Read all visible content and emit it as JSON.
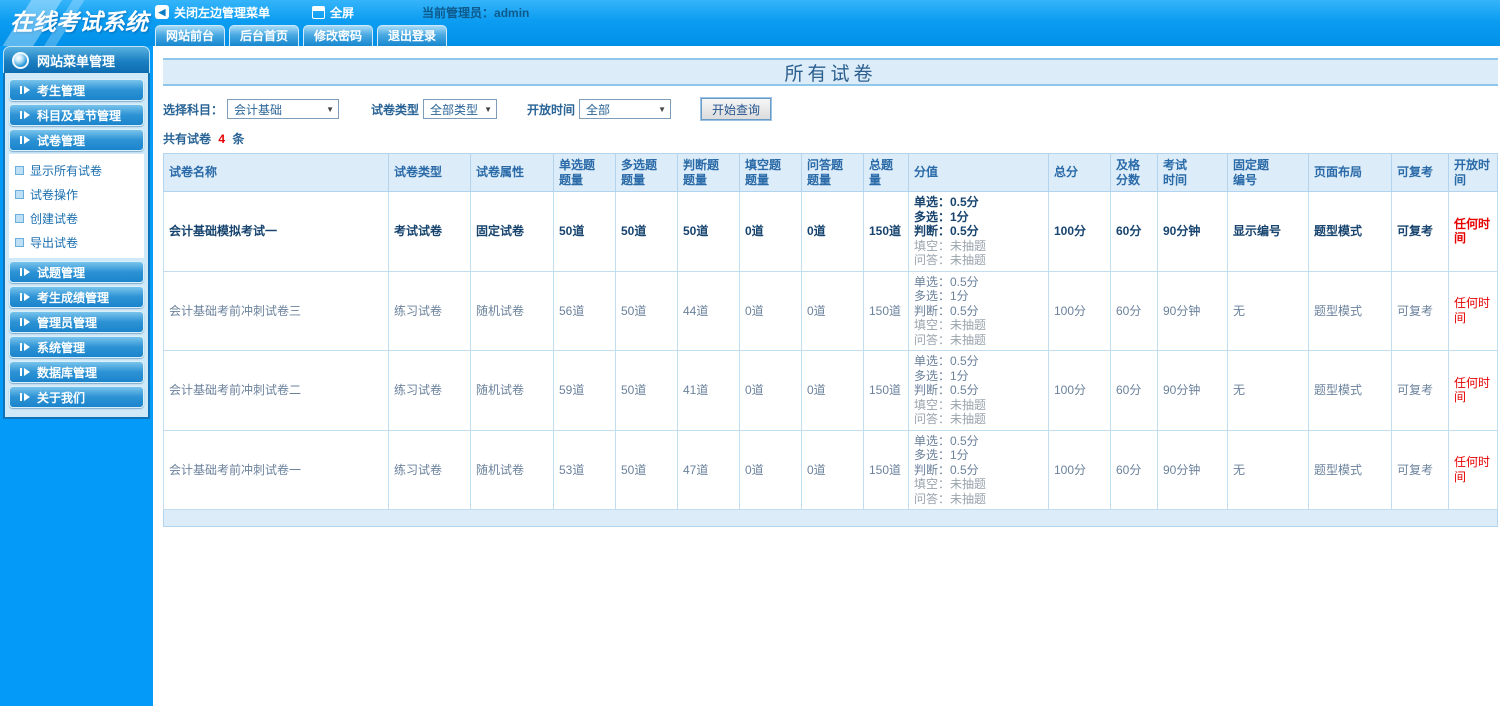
{
  "colors": {
    "topbar_blue": "#0c9df2",
    "sidebar_blue": "#049bf8",
    "accent_text": "#2a6496",
    "alert_red": "#e60000"
  },
  "topbar": {
    "logo": "在线考试系统",
    "close_menu_label": "关闭左边管理菜单",
    "fullscreen_label": "全屏",
    "admin_label": "当前管理员：admin",
    "tabs": [
      "网站前台",
      "后台首页",
      "修改密码",
      "退出登录"
    ]
  },
  "sidebar": {
    "header": "网站菜单管理",
    "items": [
      {
        "type": "button",
        "label": "考生管理"
      },
      {
        "type": "button",
        "label": "科目及章节管理"
      },
      {
        "type": "button",
        "label": "试卷管理"
      },
      {
        "type": "sub",
        "label": "显示所有试卷"
      },
      {
        "type": "sub",
        "label": "试卷操作"
      },
      {
        "type": "sub",
        "label": "创建试卷"
      },
      {
        "type": "sub",
        "label": "导出试卷"
      },
      {
        "type": "button",
        "label": "试题管理"
      },
      {
        "type": "button",
        "label": "考生成绩管理"
      },
      {
        "type": "button",
        "label": "管理员管理"
      },
      {
        "type": "button",
        "label": "系统管理"
      },
      {
        "type": "button",
        "label": "数据库管理"
      },
      {
        "type": "button",
        "label": "关于我们"
      }
    ]
  },
  "main": {
    "title": "所有试卷",
    "filters": {
      "subject_label": "选择科目：",
      "subject_value": "会计基础",
      "type_label": "试卷类型",
      "type_value": "全部类型",
      "time_label": "开放时间",
      "time_value": "全部",
      "search_button": "开始查询"
    },
    "summary": {
      "prefix": "共有试卷",
      "count": "4",
      "suffix": "条"
    },
    "table": {
      "headers": [
        [
          "试卷名称"
        ],
        [
          "试卷类型"
        ],
        [
          "试卷属性"
        ],
        [
          "单选题",
          "题量"
        ],
        [
          "多选题",
          "题量"
        ],
        [
          "判断题",
          "题量"
        ],
        [
          "填空题",
          "题量"
        ],
        [
          "问答题",
          "题量"
        ],
        [
          "总题量"
        ],
        [
          "分值"
        ],
        [
          "总分"
        ],
        [
          "及格",
          "分数"
        ],
        [
          "考试",
          "时间"
        ],
        [
          "固定题",
          "编号"
        ],
        [
          "页面布局"
        ],
        [
          "可复考"
        ],
        [
          "开放时间"
        ]
      ],
      "rows": [
        {
          "bold": true,
          "name": "会计基础模拟考试一",
          "type": "考试试卷",
          "attribute": "固定试卷",
          "single": "50道",
          "multi": "50道",
          "judge": "50道",
          "blank": "0道",
          "qa": "0道",
          "total_q": "150道",
          "score_lines": [
            {
              "text": "单选：0.5分",
              "muted": false
            },
            {
              "text": "多选：1分",
              "muted": false
            },
            {
              "text": "判断：0.5分",
              "muted": false
            },
            {
              "text": "填空：未抽题",
              "muted": true
            },
            {
              "text": "问答：未抽题",
              "muted": true
            }
          ],
          "total_score": "100分",
          "pass_score": "60分",
          "duration": "90分钟",
          "fixed_no": "显示编号",
          "layout": "题型模式",
          "retake": "可复考",
          "open_time": "任何时间"
        },
        {
          "bold": false,
          "name": "会计基础考前冲刺试卷三",
          "type": "练习试卷",
          "attribute": "随机试卷",
          "single": "56道",
          "multi": "50道",
          "judge": "44道",
          "blank": "0道",
          "qa": "0道",
          "total_q": "150道",
          "score_lines": [
            {
              "text": "单选：0.5分",
              "muted": false
            },
            {
              "text": "多选：1分",
              "muted": false
            },
            {
              "text": "判断：0.5分",
              "muted": false
            },
            {
              "text": "填空：未抽题",
              "muted": true
            },
            {
              "text": "问答：未抽题",
              "muted": true
            }
          ],
          "total_score": "100分",
          "pass_score": "60分",
          "duration": "90分钟",
          "fixed_no": "无",
          "layout": "题型模式",
          "retake": "可复考",
          "open_time": "任何时间"
        },
        {
          "bold": false,
          "name": "会计基础考前冲刺试卷二",
          "type": "练习试卷",
          "attribute": "随机试卷",
          "single": "59道",
          "multi": "50道",
          "judge": "41道",
          "blank": "0道",
          "qa": "0道",
          "total_q": "150道",
          "score_lines": [
            {
              "text": "单选：0.5分",
              "muted": false
            },
            {
              "text": "多选：1分",
              "muted": false
            },
            {
              "text": "判断：0.5分",
              "muted": false
            },
            {
              "text": "填空：未抽题",
              "muted": true
            },
            {
              "text": "问答：未抽题",
              "muted": true
            }
          ],
          "total_score": "100分",
          "pass_score": "60分",
          "duration": "90分钟",
          "fixed_no": "无",
          "layout": "题型模式",
          "retake": "可复考",
          "open_time": "任何时间"
        },
        {
          "bold": false,
          "name": "会计基础考前冲刺试卷一",
          "type": "练习试卷",
          "attribute": "随机试卷",
          "single": "53道",
          "multi": "50道",
          "judge": "47道",
          "blank": "0道",
          "qa": "0道",
          "total_q": "150道",
          "score_lines": [
            {
              "text": "单选：0.5分",
              "muted": false
            },
            {
              "text": "多选：1分",
              "muted": false
            },
            {
              "text": "判断：0.5分",
              "muted": false
            },
            {
              "text": "填空：未抽题",
              "muted": true
            },
            {
              "text": "问答：未抽题",
              "muted": true
            }
          ],
          "total_score": "100分",
          "pass_score": "60分",
          "duration": "90分钟",
          "fixed_no": "无",
          "layout": "题型模式",
          "retake": "可复考",
          "open_time": "任何时间"
        }
      ]
    }
  }
}
